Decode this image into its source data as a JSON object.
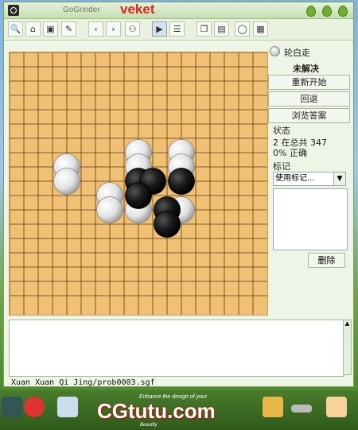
{
  "window": {
    "title": "GoGrinder",
    "brand": "veket"
  },
  "toolbar": {
    "buttons": [
      {
        "name": "search-icon",
        "glyph": "🔍"
      },
      {
        "name": "open-folder-icon",
        "glyph": "⌂"
      },
      {
        "name": "save-icon",
        "glyph": "▣"
      },
      {
        "name": "edit-icon",
        "glyph": "✎"
      },
      {
        "name": "prev-icon",
        "glyph": "‹"
      },
      {
        "name": "next-icon",
        "glyph": "›"
      },
      {
        "name": "binoculars-icon",
        "glyph": "⚇"
      },
      {
        "name": "play-icon",
        "glyph": "▶"
      },
      {
        "name": "list-icon",
        "glyph": "☰"
      },
      {
        "name": "copy-icon",
        "glyph": "❐"
      },
      {
        "name": "page-icon",
        "glyph": "▤"
      },
      {
        "name": "comment-icon",
        "glyph": "◯"
      },
      {
        "name": "image-icon",
        "glyph": "▦"
      }
    ]
  },
  "board": {
    "size": 17,
    "white": [
      [
        9,
        7
      ],
      [
        12,
        7
      ],
      [
        4,
        8
      ],
      [
        9,
        8
      ],
      [
        12,
        8
      ],
      [
        4,
        9
      ],
      [
        7,
        10
      ],
      [
        7,
        11
      ],
      [
        9,
        11
      ],
      [
        12,
        11
      ]
    ],
    "black": [
      [
        9,
        9
      ],
      [
        10,
        9
      ],
      [
        12,
        9
      ],
      [
        9,
        10
      ],
      [
        11,
        11
      ],
      [
        11,
        12
      ]
    ]
  },
  "side": {
    "turn": "轮白走",
    "state": "未解决",
    "restart": "重新开始",
    "back": "回退",
    "browse": "浏览答案",
    "status_title": "状态",
    "status_line1": "2 在总共 347",
    "status_line2": "0% 正确",
    "marks_title": "标记",
    "marks_select": "使用标记...",
    "delete": "删除"
  },
  "statusbar": {
    "path": "Xuan Xuan Qi Jing/prob0003.sgf"
  },
  "watermark": {
    "text": "CGtutu.com",
    "sub": "Enhance the design of your",
    "sub2": "Beautify"
  }
}
